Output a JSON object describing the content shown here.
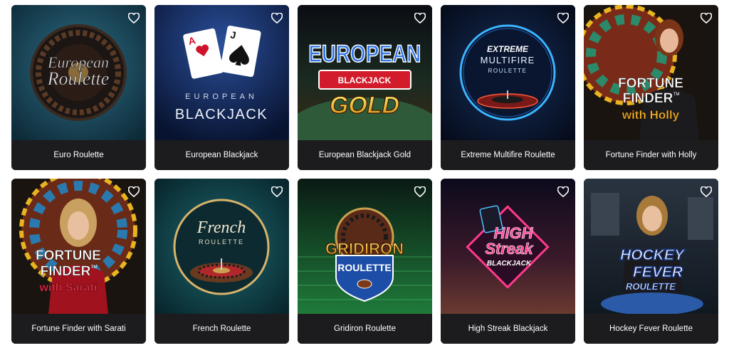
{
  "games": [
    {
      "name": "Euro Roulette",
      "art": {
        "line1": "European",
        "line2": "Roulette"
      }
    },
    {
      "name": "European Blackjack",
      "art": {
        "line1": "EUROPEAN",
        "line2": "BLACKJACK",
        "card1": "A",
        "card2": "J"
      }
    },
    {
      "name": "European Blackjack Gold",
      "art": {
        "line1": "EUROPEAN",
        "line2": "BLACKJACK",
        "line3": "GOLD"
      }
    },
    {
      "name": "Extreme Multifire Roulette",
      "art": {
        "line1": "EXTREME",
        "line2": "MULTIFIRE",
        "line3": "ROULETTE"
      }
    },
    {
      "name": "Fortune Finder with Holly",
      "art": {
        "line1": "FORTUNE",
        "line2": "FINDER",
        "tm": "TM",
        "line3": "with Holly"
      }
    },
    {
      "name": "Fortune Finder with Sarati",
      "art": {
        "line1": "FORTUNE",
        "line2": "FINDER",
        "tm": "TM",
        "line3": "with Sarati"
      }
    },
    {
      "name": "French Roulette",
      "art": {
        "line1": "French",
        "line2": "ROULETTE"
      }
    },
    {
      "name": "Gridiron Roulette",
      "art": {
        "line1": "GRIDIRON",
        "line2": "ROULETTE"
      }
    },
    {
      "name": "High Streak Blackjack",
      "art": {
        "line1": "HIGH",
        "line2": "Streak",
        "line3": "BLACKJACK"
      }
    },
    {
      "name": "Hockey Fever Roulette",
      "art": {
        "line1": "HOCKEY",
        "line2": "FEVER",
        "line3": "ROULETTE"
      }
    }
  ],
  "colors": {
    "card_bg": "#1c1c1f",
    "caption_text": "#ffffff",
    "page_bg": "#ffffff"
  },
  "icons": {
    "favorite": "heart-outline-icon"
  }
}
